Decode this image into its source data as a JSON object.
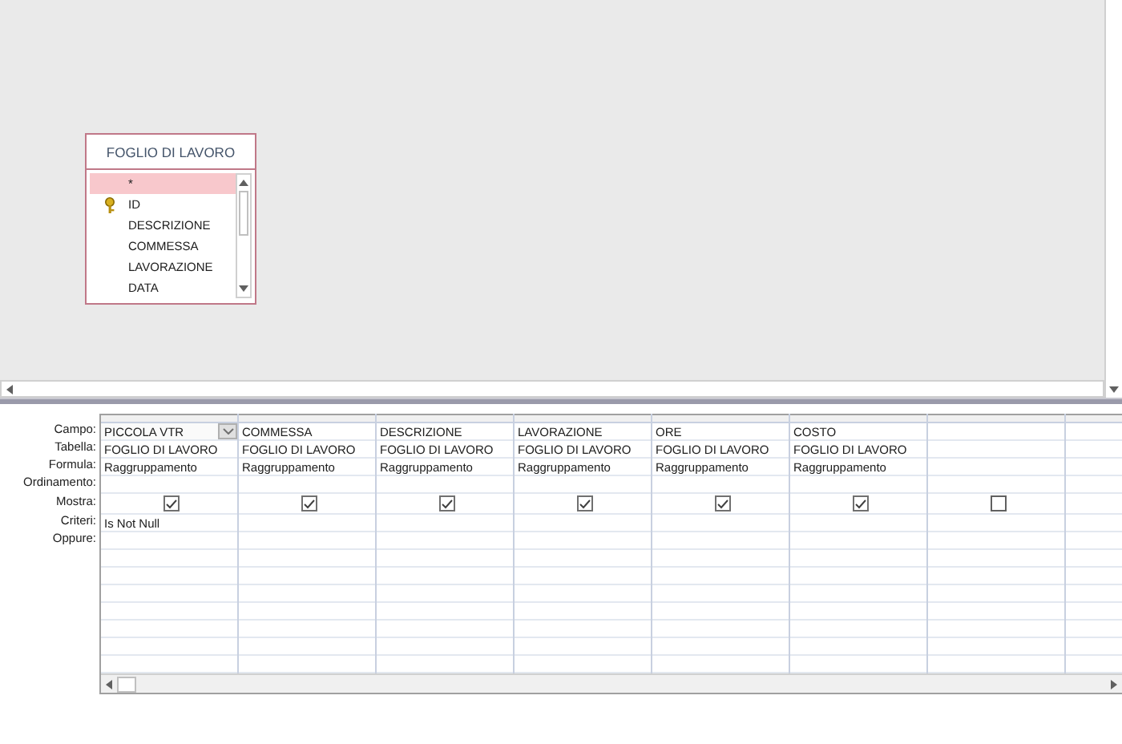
{
  "table_box": {
    "title": "FOGLIO DI LAVORO",
    "fields": [
      {
        "label": "*",
        "key": false,
        "selected": true
      },
      {
        "label": "ID",
        "key": true,
        "selected": false
      },
      {
        "label": "DESCRIZIONE",
        "key": false,
        "selected": false
      },
      {
        "label": "COMMESSA",
        "key": false,
        "selected": false
      },
      {
        "label": "LAVORAZIONE",
        "key": false,
        "selected": false
      },
      {
        "label": "DATA",
        "key": false,
        "selected": false
      }
    ]
  },
  "grid": {
    "row_labels": [
      "Campo:",
      "Tabella:",
      "Formula:",
      "Ordinamento:",
      "Mostra:",
      "Criteri:",
      "Oppure:"
    ],
    "columns": [
      {
        "campo": "PICCOLA VTR",
        "tabella": "FOGLIO DI LAVORO",
        "formula": "Raggruppamento",
        "show": true,
        "criteri": "Is Not Null",
        "selected": true
      },
      {
        "campo": "COMMESSA",
        "tabella": "FOGLIO DI LAVORO",
        "formula": "Raggruppamento",
        "show": true,
        "selected": false
      },
      {
        "campo": "DESCRIZIONE",
        "tabella": "FOGLIO DI LAVORO",
        "formula": "Raggruppamento",
        "show": true,
        "selected": false
      },
      {
        "campo": "LAVORAZIONE",
        "tabella": "FOGLIO DI LAVORO",
        "formula": "Raggruppamento",
        "show": true,
        "selected": false
      },
      {
        "campo": "ORE",
        "tabella": "FOGLIO DI LAVORO",
        "formula": "Raggruppamento",
        "show": true,
        "selected": false
      },
      {
        "campo": "COSTO",
        "tabella": "FOGLIO DI LAVORO",
        "formula": "Raggruppamento",
        "show": true,
        "selected": false
      },
      {
        "show": false,
        "selected": false
      }
    ]
  }
}
